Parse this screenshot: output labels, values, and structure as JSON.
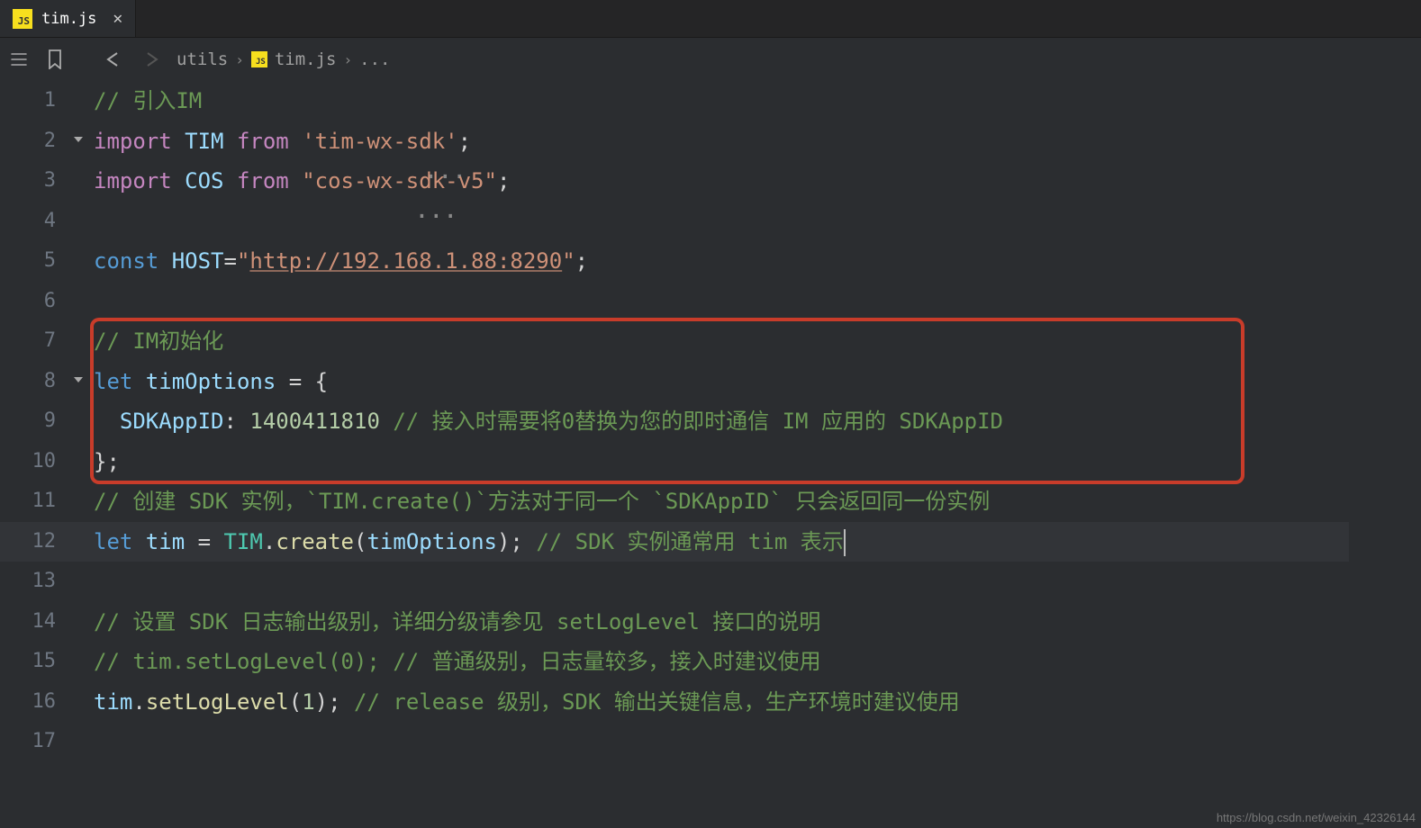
{
  "tab": {
    "filename": "tim.js",
    "css_iconText": "JS"
  },
  "toolbar": {
    "breadcrumbs": [
      "utils",
      "tim.js",
      "..."
    ]
  },
  "watermark": "https://blog.csdn.net/weixin_42326144",
  "code": {
    "lines": [
      {
        "n": 1,
        "tokens": [
          {
            "t": "// 引入IM",
            "c": "tk-cmt"
          }
        ]
      },
      {
        "n": 2,
        "fold": "v",
        "tokens": [
          {
            "t": "import ",
            "c": "tk-kw"
          },
          {
            "t": "TIM ",
            "c": "tk-var"
          },
          {
            "t": "from ",
            "c": "tk-kw"
          },
          {
            "t": "'",
            "c": "tk-str"
          },
          {
            "t": "tim-wx-sdk",
            "c": "tk-warn"
          },
          {
            "t": "'",
            "c": "tk-str"
          },
          {
            "t": ";",
            "c": "tk-punct"
          }
        ]
      },
      {
        "n": 3,
        "tokens": [
          {
            "t": "import ",
            "c": "tk-kw"
          },
          {
            "t": "COS ",
            "c": "tk-var"
          },
          {
            "t": "from ",
            "c": "tk-kw"
          },
          {
            "t": "\"",
            "c": "tk-str"
          },
          {
            "t": "cos-wx-sdk-v5",
            "c": "tk-warn"
          },
          {
            "t": "\"",
            "c": "tk-str"
          },
          {
            "t": ";",
            "c": "tk-punct"
          }
        ]
      },
      {
        "n": 4,
        "tokens": []
      },
      {
        "n": 5,
        "tokens": [
          {
            "t": "const ",
            "c": "tk-kw3"
          },
          {
            "t": "HOST",
            "c": "tk-var"
          },
          {
            "t": "=",
            "c": "tk-op"
          },
          {
            "t": "\"",
            "c": "tk-str"
          },
          {
            "t": "http://192.168.1.88:8290",
            "c": "tk-url"
          },
          {
            "t": "\"",
            "c": "tk-str"
          },
          {
            "t": ";",
            "c": "tk-punct"
          }
        ]
      },
      {
        "n": 6,
        "tokens": []
      },
      {
        "n": 7,
        "tokens": [
          {
            "t": "// IM初始化",
            "c": "tk-cmt"
          }
        ]
      },
      {
        "n": 8,
        "fold": "v",
        "tokens": [
          {
            "t": "let ",
            "c": "tk-kw3"
          },
          {
            "t": "timOptions ",
            "c": "tk-var"
          },
          {
            "t": "= ",
            "c": "tk-op"
          },
          {
            "t": "{",
            "c": "tk-punct"
          }
        ]
      },
      {
        "n": 9,
        "indent": "  ",
        "tokens": [
          {
            "t": "SDKAppID",
            "c": "tk-prop"
          },
          {
            "t": ": ",
            "c": "tk-punct"
          },
          {
            "t": "1400411810",
            "c": "tk-num"
          },
          {
            "t": " // 接入时需要将0替换为您的即时通信 IM 应用的 SDKAppID",
            "c": "tk-cmt"
          }
        ]
      },
      {
        "n": 10,
        "tokens": [
          {
            "t": "};",
            "c": "tk-punct"
          }
        ]
      },
      {
        "n": 11,
        "tokens": [
          {
            "t": "// 创建 SDK 实例，`TIM.create()`方法对于同一个 `SDKAppID` 只会返回同一份实例",
            "c": "tk-cmt"
          }
        ]
      },
      {
        "n": 12,
        "highlight": true,
        "tokens": [
          {
            "t": "let ",
            "c": "tk-kw3"
          },
          {
            "t": "tim ",
            "c": "tk-var"
          },
          {
            "t": "= ",
            "c": "tk-op"
          },
          {
            "t": "TIM",
            "c": "tk-type"
          },
          {
            "t": ".",
            "c": "tk-punct"
          },
          {
            "t": "create",
            "c": "tk-fn"
          },
          {
            "t": "(",
            "c": "tk-punct"
          },
          {
            "t": "timOptions",
            "c": "tk-var"
          },
          {
            "t": ")",
            "c": "tk-punct"
          },
          {
            "t": "; ",
            "c": "tk-punct"
          },
          {
            "t": "// SDK 实例通常用 tim 表示",
            "c": "tk-cmt"
          },
          {
            "cursor": true
          }
        ]
      },
      {
        "n": 13,
        "tokens": []
      },
      {
        "n": 14,
        "tokens": [
          {
            "t": "// 设置 SDK 日志输出级别，详细分级请参见 setLogLevel 接口的说明",
            "c": "tk-cmt"
          }
        ]
      },
      {
        "n": 15,
        "tokens": [
          {
            "t": "// tim.setLogLevel(0); // 普通级别，日志量较多，接入时建议使用",
            "c": "tk-cmt"
          }
        ]
      },
      {
        "n": 16,
        "tokens": [
          {
            "t": "tim",
            "c": "tk-var"
          },
          {
            "t": ".",
            "c": "tk-punct"
          },
          {
            "t": "setLogLevel",
            "c": "tk-fn"
          },
          {
            "t": "(",
            "c": "tk-punct"
          },
          {
            "t": "1",
            "c": "tk-num"
          },
          {
            "t": ")",
            "c": "tk-punct"
          },
          {
            "t": "; ",
            "c": "tk-punct"
          },
          {
            "t": "// release 级别，SDK 输出关键信息，生产环境时建议使用",
            "c": "tk-cmt"
          }
        ]
      },
      {
        "n": 17,
        "tokens": []
      }
    ]
  }
}
